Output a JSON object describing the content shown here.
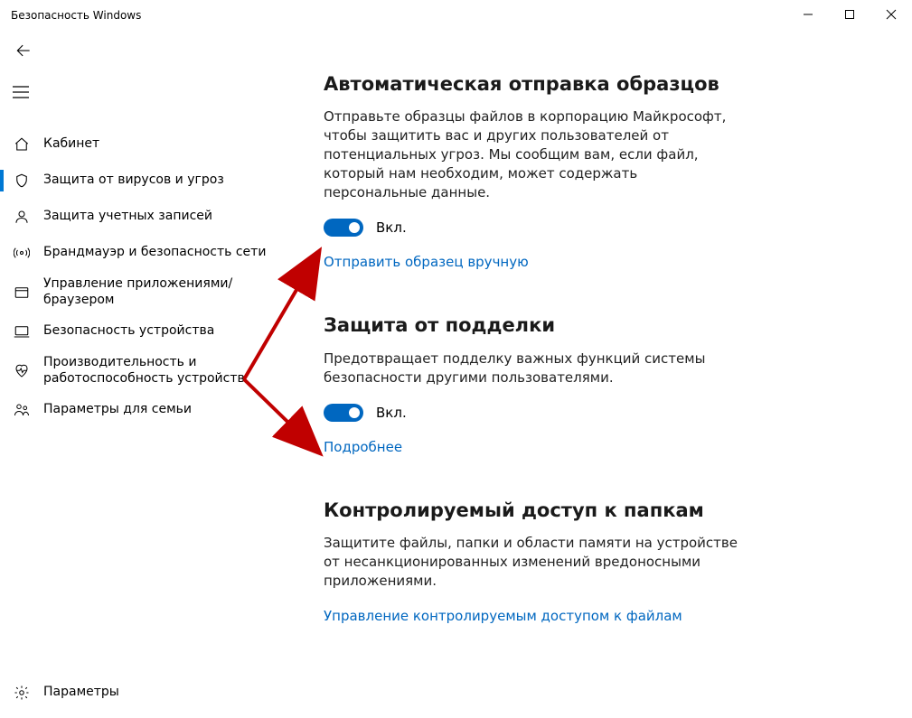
{
  "window": {
    "title": "Безопасность Windows"
  },
  "sidebar": {
    "items": [
      {
        "label": "Кабинет"
      },
      {
        "label": "Защита от вирусов и угроз"
      },
      {
        "label": "Защита учетных записей"
      },
      {
        "label": "Брандмауэр и безопасность сети"
      },
      {
        "label": "Управление приложениями/браузером"
      },
      {
        "label": "Безопасность устройства"
      },
      {
        "label": "Производительность и работоспособность устройств"
      },
      {
        "label": "Параметры для семьи"
      }
    ],
    "footer": {
      "label": "Параметры"
    }
  },
  "main": {
    "section1": {
      "title": "Автоматическая отправка образцов",
      "desc": "Отправьте образцы файлов в корпорацию Майкрософт, чтобы защитить вас и других пользователей от потенциальных угроз. Мы сообщим вам, если файл, который нам необходим, может содержать персональные данные.",
      "toggle_label": "Вкл.",
      "link": "Отправить образец вручную"
    },
    "section2": {
      "title": "Защита от подделки",
      "desc": "Предотвращает подделку важных функций системы безопасности другими пользователями.",
      "toggle_label": "Вкл.",
      "link": "Подробнее"
    },
    "section3": {
      "title": "Контролируемый доступ к папкам",
      "desc": "Защитите файлы, папки и области памяти на устройстве от несанкционированных изменений вредоносными приложениями.",
      "link": "Управление контролируемым доступом к файлам"
    }
  }
}
